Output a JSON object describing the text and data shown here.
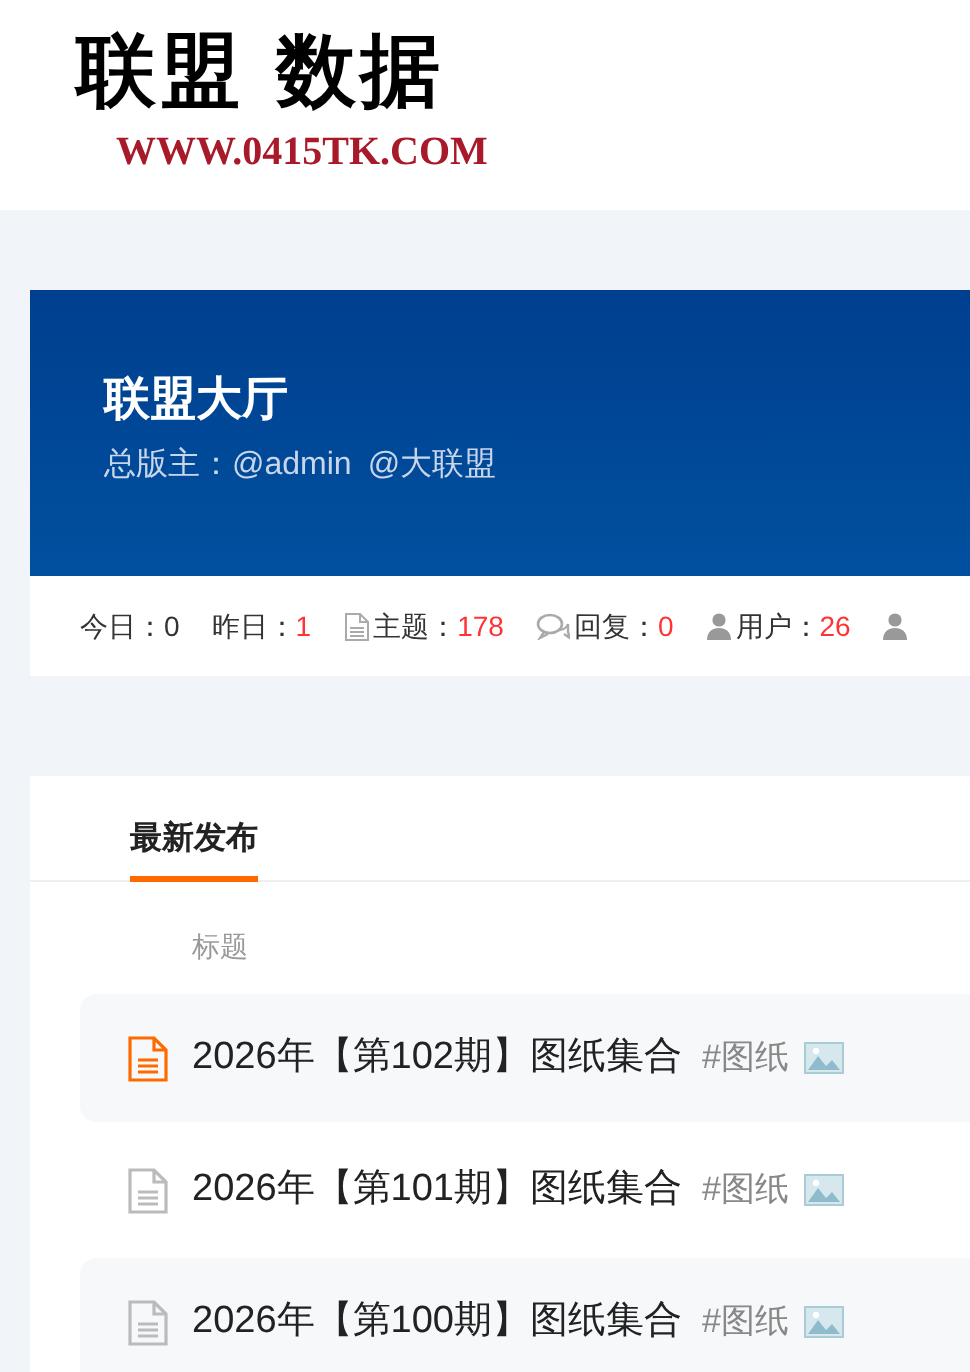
{
  "logo": {
    "title": "联盟 数据",
    "url": "WWW.0415TK.COM"
  },
  "forum": {
    "title": "联盟大厅",
    "moderator_label": "总版主：",
    "moderators": [
      "@admin",
      "@大联盟"
    ]
  },
  "stats": [
    {
      "kind": "plain",
      "label": "今日：",
      "value": "0",
      "highlight": false
    },
    {
      "kind": "plain",
      "label": "昨日：",
      "value": "1",
      "highlight": true
    },
    {
      "kind": "topics",
      "label": "主题：",
      "value": "178",
      "highlight": true
    },
    {
      "kind": "replies",
      "label": "回复：",
      "value": "0",
      "highlight": true
    },
    {
      "kind": "users",
      "label": "用户：",
      "value": "26",
      "highlight": true
    }
  ],
  "tabs": [
    {
      "label": "最新发布",
      "selected": true
    }
  ],
  "columns": [
    "标题"
  ],
  "threads": [
    {
      "title": "2026年【第102期】图纸集合",
      "tag": "#图纸",
      "new": true
    },
    {
      "title": "2026年【第101期】图纸集合",
      "tag": "#图纸",
      "new": false
    },
    {
      "title": "2026年【第100期】图纸集合",
      "tag": "#图纸",
      "new": false
    }
  ]
}
